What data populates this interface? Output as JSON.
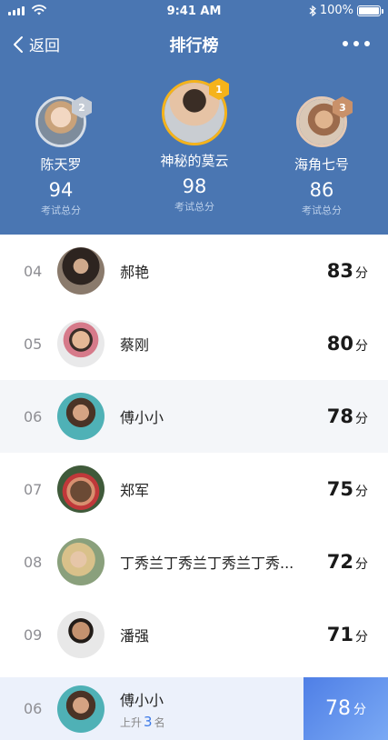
{
  "status_bar": {
    "time": "9:41 AM",
    "battery": "100%"
  },
  "nav": {
    "back_label": "返回",
    "title": "排行榜"
  },
  "podium": [
    {
      "rank": 2,
      "name": "陈天罗",
      "score": "94",
      "sub": "考试总分",
      "medal_color": "#c5ccd6"
    },
    {
      "rank": 1,
      "name": "神秘的莫云",
      "score": "98",
      "sub": "考试总分",
      "medal_color": "#f5b31b"
    },
    {
      "rank": 3,
      "name": "海角七号",
      "score": "86",
      "sub": "考试总分",
      "medal_color": "#c9916a"
    }
  ],
  "list": [
    {
      "rank": "04",
      "name": "郝艳",
      "score": "83",
      "unit": "分"
    },
    {
      "rank": "05",
      "name": "蔡刚",
      "score": "80",
      "unit": "分"
    },
    {
      "rank": "06",
      "name": "傅小小",
      "score": "78",
      "unit": "分"
    },
    {
      "rank": "07",
      "name": "郑军",
      "score": "75",
      "unit": "分"
    },
    {
      "rank": "08",
      "name": "丁秀兰丁秀兰丁秀兰丁秀...",
      "score": "72",
      "unit": "分"
    },
    {
      "rank": "09",
      "name": "潘强",
      "score": "71",
      "unit": "分"
    }
  ],
  "me": {
    "rank": "06",
    "name": "傅小小",
    "rise_prefix": "上升",
    "rise_count": "3",
    "rise_suffix": "名",
    "score": "78",
    "unit": "分"
  },
  "colors": {
    "header": "#4a76b2",
    "accent": "#3d7ae8"
  }
}
